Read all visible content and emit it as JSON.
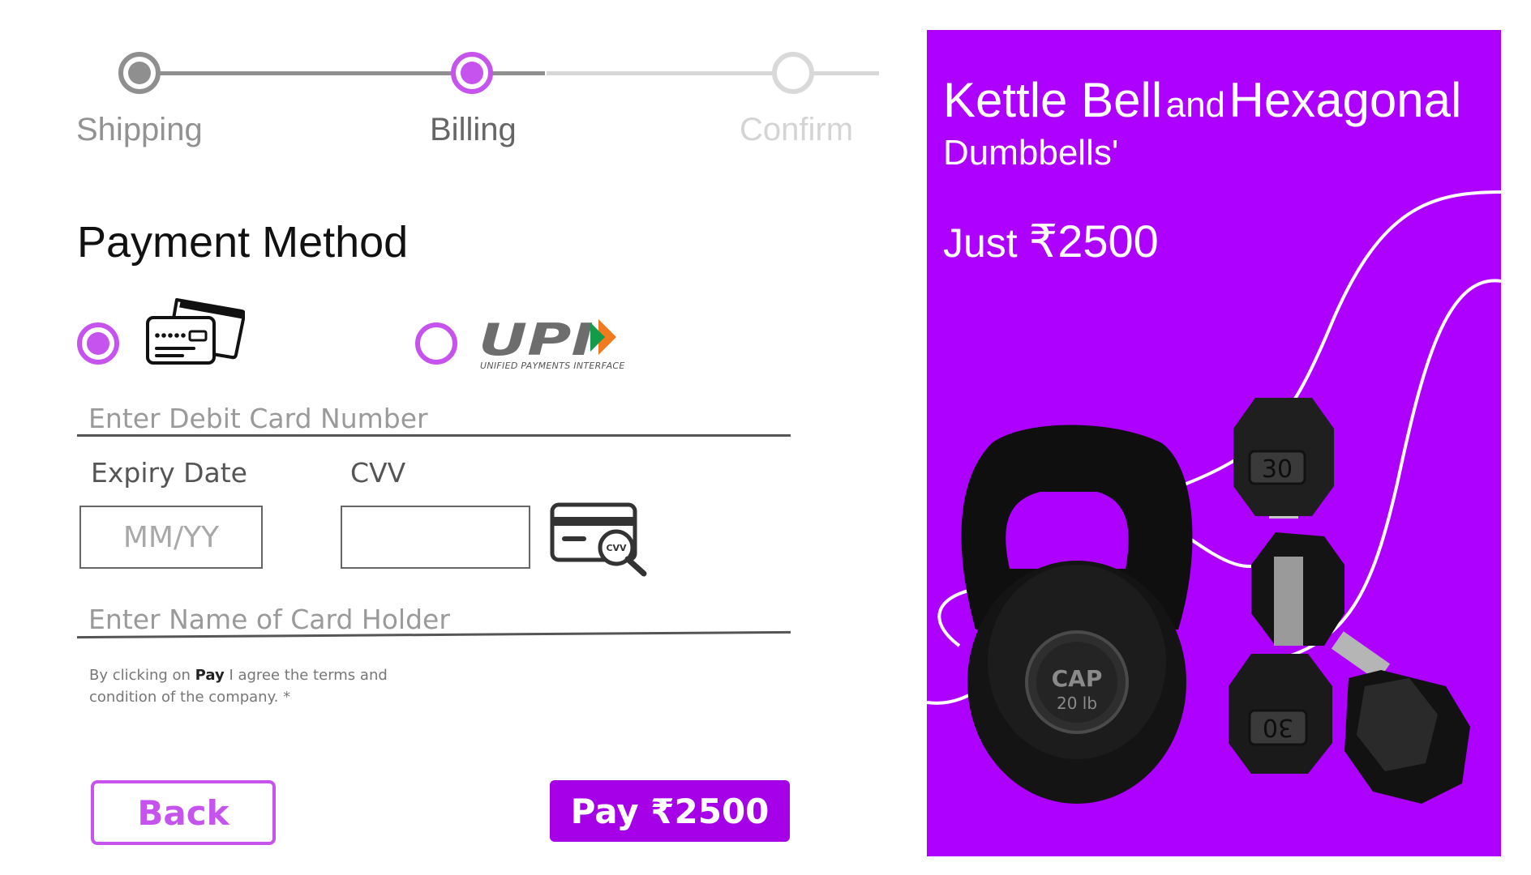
{
  "stepper": {
    "steps": [
      {
        "label": "Shipping",
        "state": "completed"
      },
      {
        "label": "Billing",
        "state": "active"
      },
      {
        "label": "Confirm",
        "state": "pending"
      }
    ]
  },
  "payment": {
    "title": "Payment Method",
    "methods": [
      {
        "id": "card",
        "icon": "credit-card-icon",
        "selected": true
      },
      {
        "id": "upi",
        "icon": "upi-logo",
        "logo_text": "UPI",
        "subtitle": "UNIFIED PAYMENTS INTERFACE",
        "selected": false
      }
    ],
    "card_number": {
      "placeholder": "Enter Debit Card Number",
      "value": ""
    },
    "expiry": {
      "label": "Expiry Date",
      "placeholder": "MM/YY",
      "value": ""
    },
    "cvv": {
      "label": "CVV",
      "value": "",
      "icon": "cvv-card-magnifier-icon",
      "icon_text": "CVV"
    },
    "card_holder": {
      "placeholder": "Enter Name of Card Holder",
      "value": ""
    },
    "terms": {
      "prefix": "By clicking on",
      "bold": "Pay",
      "suffix": "I agree the terms and condition of the company. *"
    },
    "back_label": "Back",
    "pay_label": "Pay ₹2500"
  },
  "promo": {
    "title_part1": "Kettle Bell",
    "title_and": "and",
    "title_part2": "Hexagonal",
    "title_line2": "Dumbbells'",
    "price_prefix": "Just",
    "price": "₹2500",
    "kettlebell_brand": "CAP",
    "kettlebell_weight": "20 lb",
    "dumbbell_weight": "30",
    "bg_color": "#ad00ff"
  },
  "colors": {
    "accent": "#c653ee",
    "pay_button": "#a600e9",
    "inactive": "#8f8f8f"
  }
}
